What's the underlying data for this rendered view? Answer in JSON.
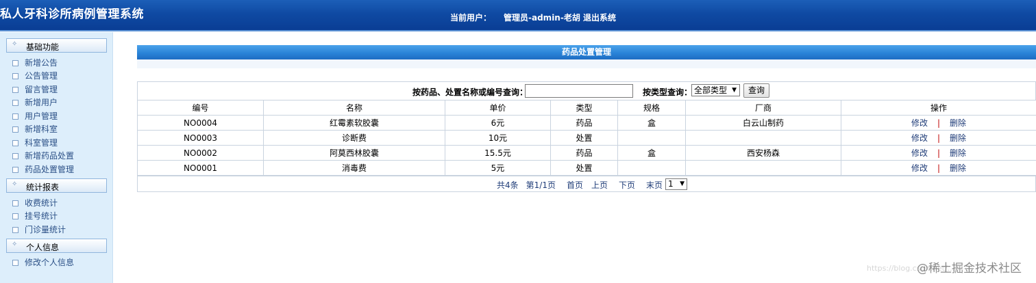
{
  "header": {
    "app_title": "私人牙科诊所病例管理系统",
    "current_user_label": "当前用户：",
    "current_user": "管理员-admin-老胡",
    "logout": "退出系统"
  },
  "sidebar": {
    "groups": [
      {
        "title": "基础功能",
        "items": [
          "新增公告",
          "公告管理",
          "留言管理",
          "新增用户",
          "用户管理",
          "新增科室",
          "科室管理",
          "新增药品处置",
          "药品处置管理"
        ]
      },
      {
        "title": "统计报表",
        "items": [
          "收费统计",
          "挂号统计",
          "门诊量统计"
        ]
      },
      {
        "title": "个人信息",
        "items": [
          "修改个人信息"
        ]
      }
    ]
  },
  "main": {
    "panel_title": "药品处置管理",
    "search": {
      "label": "按药品、处置名称或编号查询：",
      "value": "",
      "type_label": "按类型查询：",
      "type_selected": "全部类型",
      "button": "查询"
    },
    "table": {
      "columns": [
        "编号",
        "名称",
        "单价",
        "类型",
        "规格",
        "厂商",
        "操作"
      ],
      "rows": [
        [
          "NO0004",
          "红霉素软胶囊",
          "6元",
          "药品",
          "盒",
          "白云山制药"
        ],
        [
          "NO0003",
          "诊断费",
          "10元",
          "处置",
          "",
          ""
        ],
        [
          "NO0002",
          "阿莫西林胶囊",
          "15.5元",
          "药品",
          "盒",
          "西安杨森"
        ],
        [
          "NO0001",
          "消毒费",
          "5元",
          "处置",
          "",
          ""
        ]
      ],
      "edit_label": "修改",
      "separator": "|",
      "delete_label": "删除"
    },
    "pager": {
      "total": "共4条",
      "page_info": "第1/1页",
      "first": "首页",
      "prev": "上页",
      "next": "下页",
      "last": "末页",
      "page_selected": "1"
    }
  },
  "watermark": {
    "text": "@稀土掘金技术社区",
    "url": "https://blog.csdn.net/..."
  },
  "colors": {
    "header_bg": "#0f4aa3",
    "sidebar_bg": "#ddeefb",
    "panel_title_bg": "#2a84d8",
    "link": "#1f3c78",
    "separator": "#c00000"
  }
}
